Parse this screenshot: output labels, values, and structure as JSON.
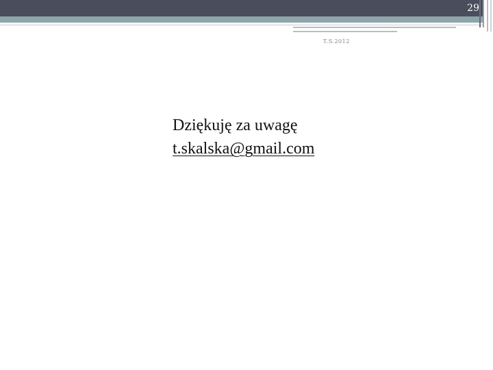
{
  "slide": {
    "page_number": "29",
    "footer_note": "T.S.2012",
    "thanks_text": "Dziękuję za uwagę",
    "email": "t.skalska@gmail.com"
  },
  "colors": {
    "header_dark": "#4a4d5c",
    "header_teal": "#8ea6ab",
    "text": "#111111",
    "footer_text": "#7f858c"
  }
}
